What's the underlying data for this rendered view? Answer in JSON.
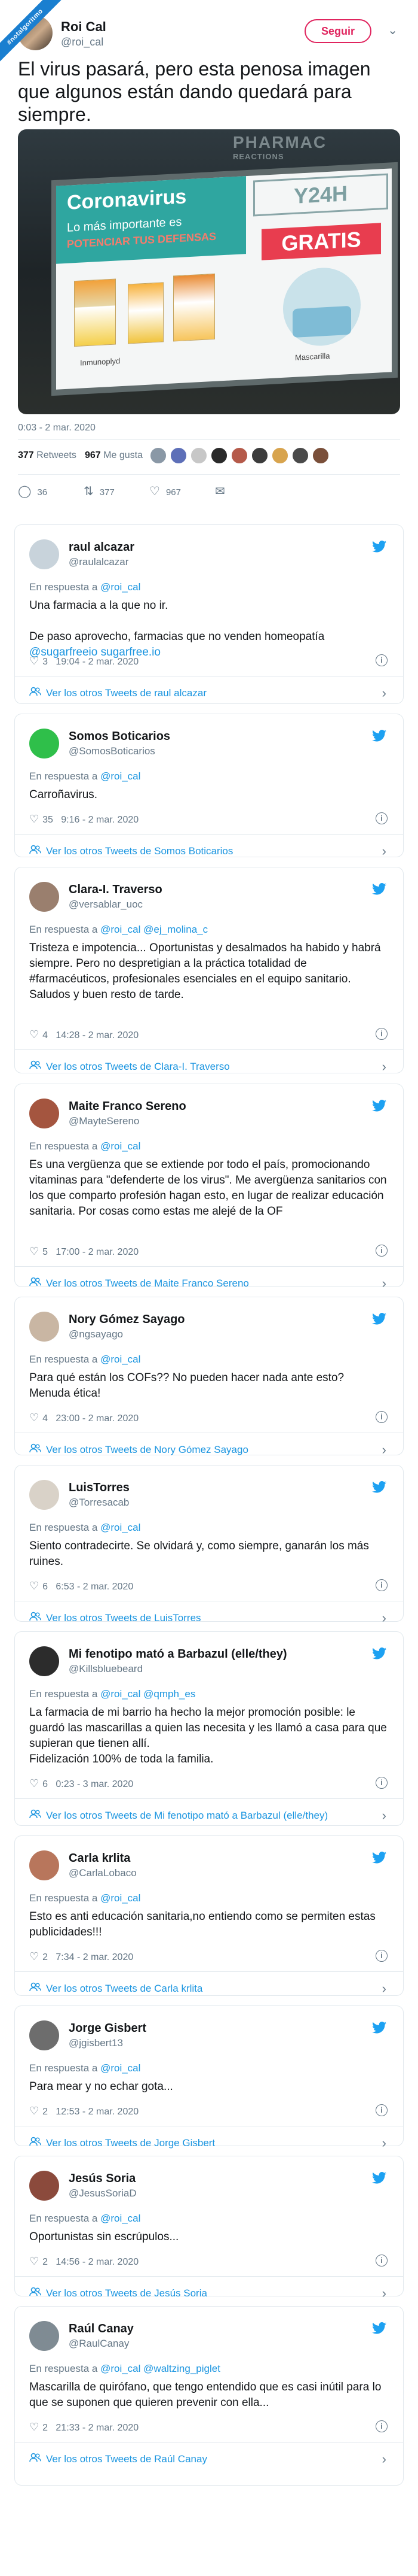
{
  "ribbon": "#notalgoritmo",
  "main": {
    "name": "Roi Cal",
    "handle": "@roi_cal",
    "follow_label": "Seguir",
    "text": "El virus pasará, pero esta penosa imagen que algunos están dando quedará para siempre.",
    "photo": {
      "sign_bg": "PHARMAC",
      "sign_bg2": "REACTIONS",
      "poster_title": "Coronavirus",
      "poster_sub": "Lo más importante es",
      "poster_sub2": "POTENCIAR TUS DEFENSAS",
      "poster_brand": "Y24H",
      "poster_free": "GRATIS",
      "label_left": "Inmunoplyd",
      "label_right": "Mascarilla"
    },
    "time": "0:03 - 2 mar. 2020",
    "retweets": "377",
    "retweets_label": "Retweets",
    "likes": "967",
    "likes_label": "Me gusta",
    "actions": {
      "replies": "36",
      "retweets": "377",
      "likes": "967"
    }
  },
  "colors": {
    "accent": "#1b95e0",
    "follow": "#e0245e",
    "muted": "#657786",
    "text": "#14171a"
  },
  "replies": [
    {
      "name": "raul alcazar",
      "handle": "@raulalcazar",
      "in_reply_to": "@roi_cal",
      "text": "Una farmacia a la que no ir.\n\nDe paso aprovecho, farmacias que no venden homeopatía",
      "link1": "@sugarfreeio",
      "link2": "sugarfree.io",
      "likes": "3",
      "time": "19:04 - 2 mar. 2020",
      "more": "Ver los otros Tweets de raul alcazar"
    },
    {
      "name": "Somos Boticarios",
      "handle": "@SomosBoticarios",
      "in_reply_to": "@roi_cal",
      "text": "Carroñavirus.",
      "likes": "35",
      "time": "9:16 - 2 mar. 2020",
      "more": "Ver los otros Tweets de Somos Boticarios"
    },
    {
      "name": "Clara-I. Traverso",
      "handle": "@versablar_uoc",
      "in_reply_to": "@roi_cal",
      "in_reply_to2": "@ej_molina_c",
      "text": "Tristeza e impotencia... Oportunistas y desalmados ha habido y habrá siempre. Pero no despretigian a la práctica totalidad de #farmacéuticos, profesionales esenciales en el equipo sanitario. Saludos y buen resto de tarde.",
      "likes": "4",
      "time": "14:28 - 2 mar. 2020",
      "more": "Ver los otros Tweets de Clara-I. Traverso"
    },
    {
      "name": "Maite Franco Sereno",
      "handle": "@MayteSereno",
      "in_reply_to": "@roi_cal",
      "text": "Es una vergüenza que se extiende por todo el país, promocionando vitaminas para \"defenderte de los virus\". Me avergüenza sanitarios con los que comparto profesión hagan esto, en lugar de realizar educación sanitaria. Por cosas como estas me alejé de la OF",
      "likes": "5",
      "time": "17:00 - 2 mar. 2020",
      "more": "Ver los otros Tweets de Maite Franco Sereno"
    },
    {
      "name": "Nory Gómez Sayago",
      "handle": "@ngsayago",
      "in_reply_to": "@roi_cal",
      "text": "Para qué están los COFs?? No pueden hacer nada ante esto? Menuda ética!",
      "likes": "4",
      "time": "23:00 - 2 mar. 2020",
      "more": "Ver los otros Tweets de Nory Gómez Sayago"
    },
    {
      "name": "LuisTorres",
      "handle": "@Torresacab",
      "in_reply_to": "@roi_cal",
      "text": "Siento contradecirte. Se olvidará y, como siempre, ganarán los más ruines.",
      "likes": "6",
      "time": "6:53 - 2 mar. 2020",
      "more": "Ver los otros Tweets de LuisTorres"
    },
    {
      "name": "Mi fenotipo mató a Barbazul (elle/they)",
      "handle": "@Killsbluebeard",
      "in_reply_to": "@roi_cal",
      "in_reply_to2": "@qmph_es",
      "text": "La farmacia de mi barrio ha hecho la mejor promoción posible: le guardó las mascarillas a quien las necesita y les llamó a casa para que supieran que tienen allí.\nFidelización 100% de toda la familia.",
      "likes": "6",
      "time": "0:23 - 3 mar. 2020",
      "more": "Ver los otros Tweets de Mi fenotipo mató a Barbazul (elle/they)"
    },
    {
      "name": "Carla krlita",
      "handle": "@CarlaLobaco",
      "in_reply_to": "@roi_cal",
      "text": "Esto es anti educación sanitaria,no entiendo como se permiten estas publicidades!!!",
      "likes": "2",
      "time": "7:34 - 2 mar. 2020",
      "more": "Ver los otros Tweets de Carla krlita"
    },
    {
      "name": "Jorge Gisbert",
      "handle": "@jgisbert13",
      "in_reply_to": "@roi_cal",
      "text": "Para mear y no echar gota...",
      "likes": "2",
      "time": "12:53 - 2 mar. 2020",
      "more": "Ver los otros Tweets de Jorge Gisbert"
    },
    {
      "name": "Jesús Soria",
      "handle": "@JesusSoriaD",
      "in_reply_to": "@roi_cal",
      "text": "Oportunistas sin escrúpulos...",
      "likes": "2",
      "time": "14:56 - 2 mar. 2020",
      "more": "Ver los otros Tweets de Jesús Soria"
    },
    {
      "name": "Raúl Canay",
      "handle": "@RaulCanay",
      "in_reply_to": "@roi_cal",
      "in_reply_to2": "@waltzing_piglet",
      "text": "Mascarilla de quirófano, que tengo entendido que es casi inútil para lo que se suponen que quieren prevenir con ella...",
      "likes": "2",
      "time": "21:33 - 2 mar. 2020",
      "more": "Ver los otros Tweets de Raúl Canay"
    }
  ]
}
